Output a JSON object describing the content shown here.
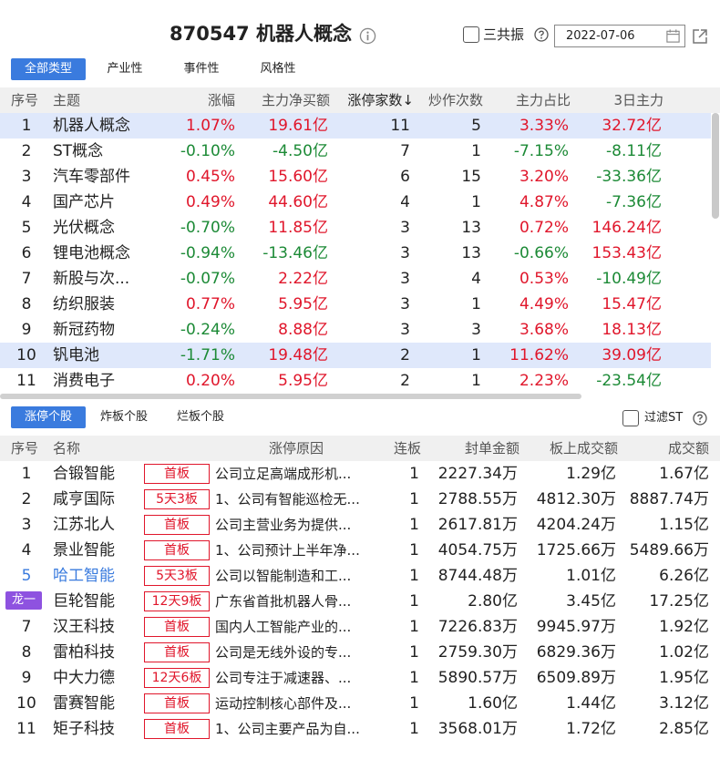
{
  "header": {
    "title": "870547 机器人概念",
    "checkbox_label": "三共振",
    "date": "2022-07-06"
  },
  "sector_tabs": [
    "全部类型",
    "产业性",
    "事件性",
    "风格性"
  ],
  "sector_columns": [
    "序号",
    "主题",
    "涨幅",
    "主力净买额",
    "涨停家数↓",
    "炒作次数",
    "主力占比",
    "3日主力"
  ],
  "sector_rows": [
    {
      "no": "1",
      "name": "机器人概念",
      "change": "1.07%",
      "net_buy": "19.61亿",
      "limit_up": "11",
      "hype": "5",
      "ratio": "3.33%",
      "three_day": "32.72亿",
      "selected": true
    },
    {
      "no": "2",
      "name": "ST概念",
      "change": "-0.10%",
      "net_buy": "-4.50亿",
      "limit_up": "7",
      "hype": "1",
      "ratio": "-7.15%",
      "three_day": "-8.11亿",
      "selected": false
    },
    {
      "no": "3",
      "name": "汽车零部件",
      "change": "0.45%",
      "net_buy": "15.60亿",
      "limit_up": "6",
      "hype": "15",
      "ratio": "3.20%",
      "three_day": "-33.36亿",
      "selected": false
    },
    {
      "no": "4",
      "name": "国产芯片",
      "change": "0.49%",
      "net_buy": "44.60亿",
      "limit_up": "4",
      "hype": "1",
      "ratio": "4.87%",
      "three_day": "-7.36亿",
      "selected": false
    },
    {
      "no": "5",
      "name": "光伏概念",
      "change": "-0.70%",
      "net_buy": "11.85亿",
      "limit_up": "3",
      "hype": "13",
      "ratio": "0.72%",
      "three_day": "146.24亿",
      "selected": false
    },
    {
      "no": "6",
      "name": "锂电池概念",
      "change": "-0.94%",
      "net_buy": "-13.46亿",
      "limit_up": "3",
      "hype": "13",
      "ratio": "-0.66%",
      "three_day": "153.43亿",
      "selected": false
    },
    {
      "no": "7",
      "name": "新股与次...",
      "change": "-0.07%",
      "net_buy": "2.22亿",
      "limit_up": "3",
      "hype": "4",
      "ratio": "0.53%",
      "three_day": "-10.49亿",
      "selected": false
    },
    {
      "no": "8",
      "name": "纺织服装",
      "change": "0.77%",
      "net_buy": "5.95亿",
      "limit_up": "3",
      "hype": "1",
      "ratio": "4.49%",
      "three_day": "15.47亿",
      "selected": false
    },
    {
      "no": "9",
      "name": "新冠药物",
      "change": "-0.24%",
      "net_buy": "8.88亿",
      "limit_up": "3",
      "hype": "3",
      "ratio": "3.68%",
      "three_day": "18.13亿",
      "selected": false
    },
    {
      "no": "10",
      "name": "钒电池",
      "change": "-1.71%",
      "net_buy": "19.48亿",
      "limit_up": "2",
      "hype": "1",
      "ratio": "11.62%",
      "three_day": "39.09亿",
      "selected": true
    },
    {
      "no": "11",
      "name": "消费电子",
      "change": "0.20%",
      "net_buy": "5.95亿",
      "limit_up": "2",
      "hype": "1",
      "ratio": "2.23%",
      "three_day": "-23.54亿",
      "selected": false
    }
  ],
  "stock_tabs": [
    "涨停个股",
    "炸板个股",
    "烂板个股"
  ],
  "filter_st_label": "过滤ST",
  "stock_columns": [
    "序号",
    "名称",
    "涨停原因",
    "连板",
    "封单金额",
    "板上成交额",
    "成交额"
  ],
  "stock_rows": [
    {
      "no": "1",
      "dragon": "",
      "name": "合锻智能",
      "badge": "首板",
      "reason": "公司立足高端成形机...",
      "streak": "1",
      "seal": "2227.34万",
      "board_amt": "1.29亿",
      "amount": "1.67亿",
      "highlight": false
    },
    {
      "no": "2",
      "dragon": "",
      "name": "咸亨国际",
      "badge": "5天3板",
      "reason": "1、公司有智能巡检无...",
      "streak": "1",
      "seal": "2788.55万",
      "board_amt": "4812.30万",
      "amount": "8887.74万",
      "highlight": false
    },
    {
      "no": "3",
      "dragon": "",
      "name": "江苏北人",
      "badge": "首板",
      "reason": "公司主营业务为提供...",
      "streak": "1",
      "seal": "2617.81万",
      "board_amt": "4204.24万",
      "amount": "1.15亿",
      "highlight": false
    },
    {
      "no": "4",
      "dragon": "",
      "name": "景业智能",
      "badge": "首板",
      "reason": "1、公司预计上半年净...",
      "streak": "1",
      "seal": "4054.75万",
      "board_amt": "1725.66万",
      "amount": "5489.66万",
      "highlight": false
    },
    {
      "no": "5",
      "dragon": "",
      "name": "哈工智能",
      "badge": "5天3板",
      "reason": "公司以智能制造和工...",
      "streak": "1",
      "seal": "8744.48万",
      "board_amt": "1.01亿",
      "amount": "6.26亿",
      "highlight": true
    },
    {
      "no": "",
      "dragon": "龙一",
      "name": "巨轮智能",
      "badge": "12天9板",
      "reason": "广东省首批机器人骨...",
      "streak": "1",
      "seal": "2.80亿",
      "board_amt": "3.45亿",
      "amount": "17.25亿",
      "highlight": false
    },
    {
      "no": "7",
      "dragon": "",
      "name": "汉王科技",
      "badge": "首板",
      "reason": "国内人工智能产业的...",
      "streak": "1",
      "seal": "7226.83万",
      "board_amt": "9945.97万",
      "amount": "1.92亿",
      "highlight": false
    },
    {
      "no": "8",
      "dragon": "",
      "name": "雷柏科技",
      "badge": "首板",
      "reason": "公司是无线外设的专...",
      "streak": "1",
      "seal": "2759.30万",
      "board_amt": "6829.36万",
      "amount": "1.02亿",
      "highlight": false
    },
    {
      "no": "9",
      "dragon": "",
      "name": "中大力德",
      "badge": "12天6板",
      "reason": "公司专注于减速器、...",
      "streak": "1",
      "seal": "5890.57万",
      "board_amt": "6509.89万",
      "amount": "1.95亿",
      "highlight": false
    },
    {
      "no": "10",
      "dragon": "",
      "name": "雷赛智能",
      "badge": "首板",
      "reason": "运动控制核心部件及...",
      "streak": "1",
      "seal": "1.60亿",
      "board_amt": "1.44亿",
      "amount": "3.12亿",
      "highlight": false
    },
    {
      "no": "11",
      "dragon": "",
      "name": "矩子科技",
      "badge": "首板",
      "reason": "1、公司主要产品为自...",
      "streak": "1",
      "seal": "3568.01万",
      "board_amt": "1.72亿",
      "amount": "2.85亿",
      "highlight": false
    }
  ],
  "colors": {
    "accent": "#3a7bde",
    "up": "#e0162b",
    "down": "#1c8a36",
    "selected_row": "#dfe8fb",
    "dragon_badge": "#8e52e0"
  }
}
